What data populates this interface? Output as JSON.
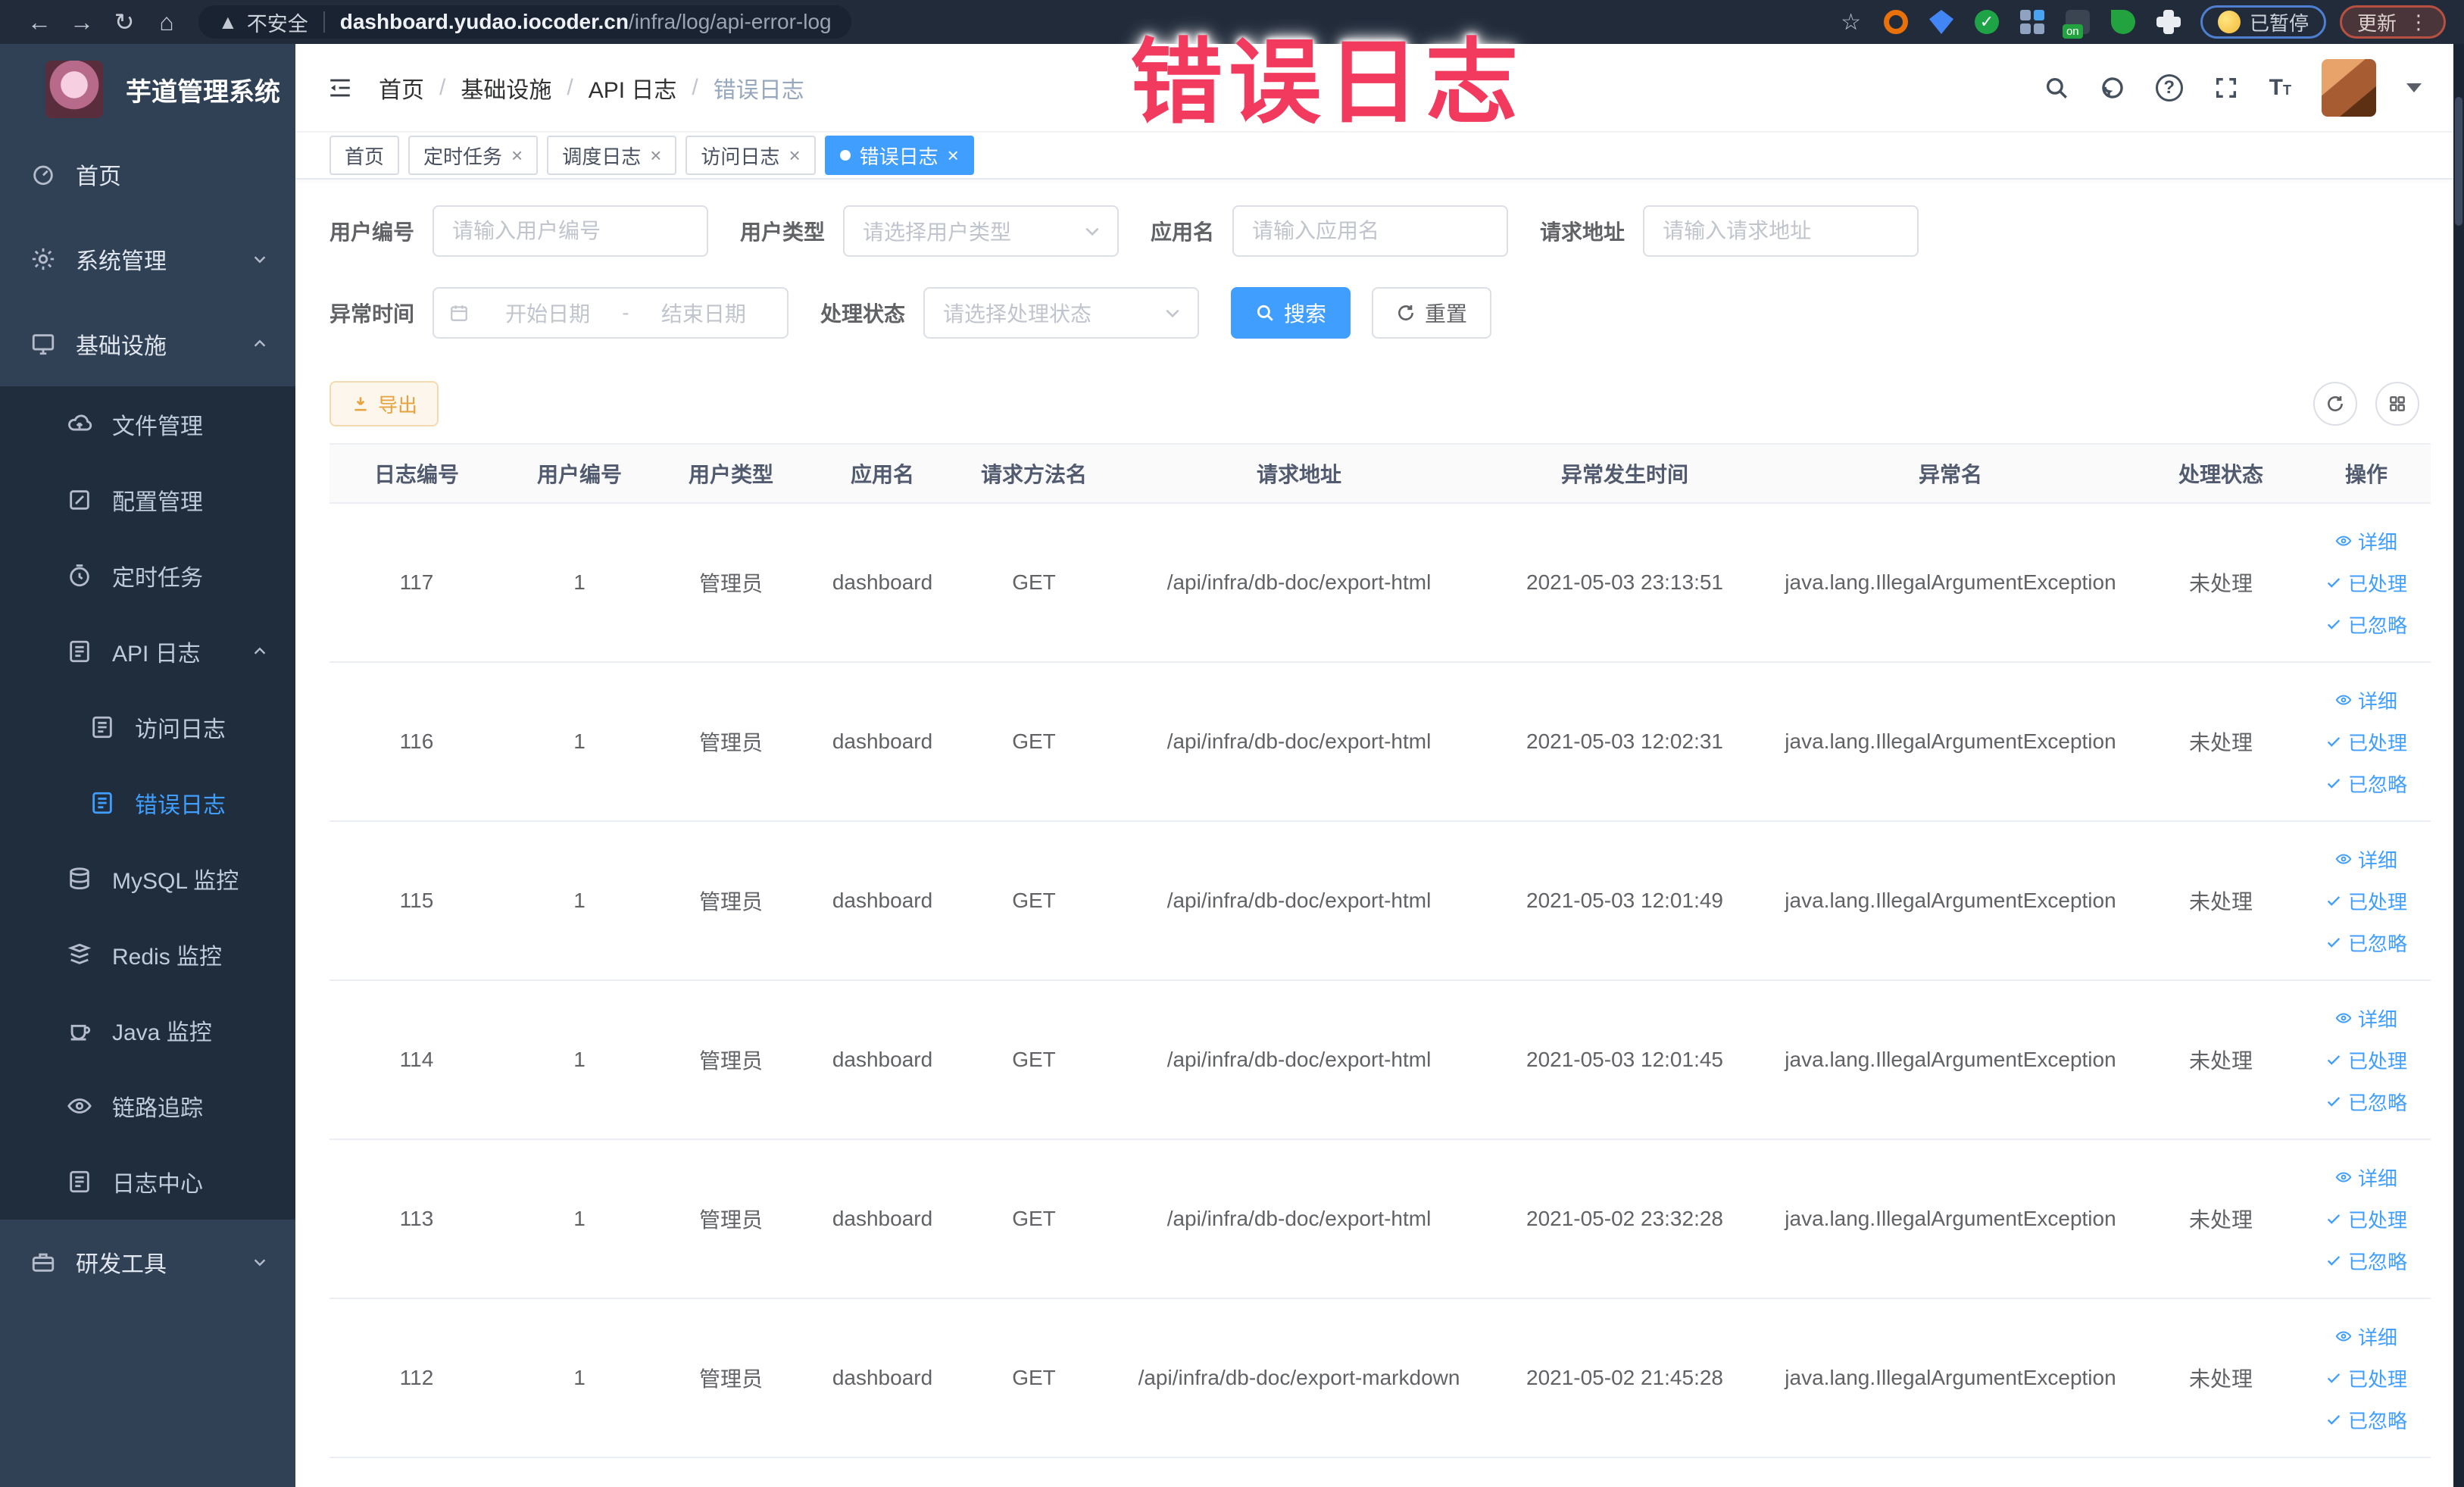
{
  "browser": {
    "security_label": "不安全",
    "url_host": "dashboard.yudao.iocoder.cn",
    "url_path": "/infra/log/api-error-log",
    "paused_pill": "已暂停",
    "update_pill": "更新"
  },
  "overlay": {
    "title": "错误日志"
  },
  "sidebar": {
    "app_title": "芋道管理系统",
    "items": [
      {
        "label": "首页"
      },
      {
        "label": "系统管理"
      },
      {
        "label": "基础设施"
      },
      {
        "label": "文件管理"
      },
      {
        "label": "配置管理"
      },
      {
        "label": "定时任务"
      },
      {
        "label": "API 日志"
      },
      {
        "label": "访问日志"
      },
      {
        "label": "错误日志"
      },
      {
        "label": "MySQL 监控"
      },
      {
        "label": "Redis 监控"
      },
      {
        "label": "Java 监控"
      },
      {
        "label": "链路追踪"
      },
      {
        "label": "日志中心"
      },
      {
        "label": "研发工具"
      }
    ]
  },
  "breadcrumb": [
    "首页",
    "基础设施",
    "API 日志",
    "错误日志"
  ],
  "tabs": [
    {
      "label": "首页"
    },
    {
      "label": "定时任务"
    },
    {
      "label": "调度日志"
    },
    {
      "label": "访问日志"
    },
    {
      "label": "错误日志"
    }
  ],
  "filters": {
    "user_id": {
      "label": "用户编号",
      "placeholder": "请输入用户编号"
    },
    "user_type": {
      "label": "用户类型",
      "placeholder": "请选择用户类型"
    },
    "app_name": {
      "label": "应用名",
      "placeholder": "请输入应用名"
    },
    "request_url": {
      "label": "请求地址",
      "placeholder": "请输入请求地址"
    },
    "exception_time": {
      "label": "异常时间",
      "start_placeholder": "开始日期",
      "separator": "-",
      "end_placeholder": "结束日期"
    },
    "process_status": {
      "label": "处理状态",
      "placeholder": "请选择处理状态"
    },
    "search_label": "搜索",
    "reset_label": "重置"
  },
  "toolbar": {
    "export_label": "导出"
  },
  "table": {
    "columns": [
      "日志编号",
      "用户编号",
      "用户类型",
      "应用名",
      "请求方法名",
      "请求地址",
      "异常发生时间",
      "异常名",
      "处理状态",
      "操作"
    ],
    "actions": [
      "详细",
      "已处理",
      "已忽略"
    ],
    "rows": [
      {
        "id": "117",
        "user_id": "1",
        "user_type": "管理员",
        "app": "dashboard",
        "method": "GET",
        "url": "/api/infra/db-doc/export-html",
        "time": "2021-05-03 23:13:51",
        "exception": "java.lang.IllegalArgumentException",
        "status": "未处理"
      },
      {
        "id": "116",
        "user_id": "1",
        "user_type": "管理员",
        "app": "dashboard",
        "method": "GET",
        "url": "/api/infra/db-doc/export-html",
        "time": "2021-05-03 12:02:31",
        "exception": "java.lang.IllegalArgumentException",
        "status": "未处理"
      },
      {
        "id": "115",
        "user_id": "1",
        "user_type": "管理员",
        "app": "dashboard",
        "method": "GET",
        "url": "/api/infra/db-doc/export-html",
        "time": "2021-05-03 12:01:49",
        "exception": "java.lang.IllegalArgumentException",
        "status": "未处理"
      },
      {
        "id": "114",
        "user_id": "1",
        "user_type": "管理员",
        "app": "dashboard",
        "method": "GET",
        "url": "/api/infra/db-doc/export-html",
        "time": "2021-05-03 12:01:45",
        "exception": "java.lang.IllegalArgumentException",
        "status": "未处理"
      },
      {
        "id": "113",
        "user_id": "1",
        "user_type": "管理员",
        "app": "dashboard",
        "method": "GET",
        "url": "/api/infra/db-doc/export-html",
        "time": "2021-05-02 23:32:28",
        "exception": "java.lang.IllegalArgumentException",
        "status": "未处理"
      },
      {
        "id": "112",
        "user_id": "1",
        "user_type": "管理员",
        "app": "dashboard",
        "method": "GET",
        "url": "/api/infra/db-doc/export-markdown",
        "time": "2021-05-02 21:45:28",
        "exception": "java.lang.IllegalArgumentException",
        "status": "未处理"
      }
    ]
  },
  "colors": {
    "primary": "#409eff",
    "warning": "#e6a23c",
    "overlay_red": "#f23a5e",
    "sidebar_bg": "#304156",
    "submenu_bg": "#1f2d3d"
  }
}
